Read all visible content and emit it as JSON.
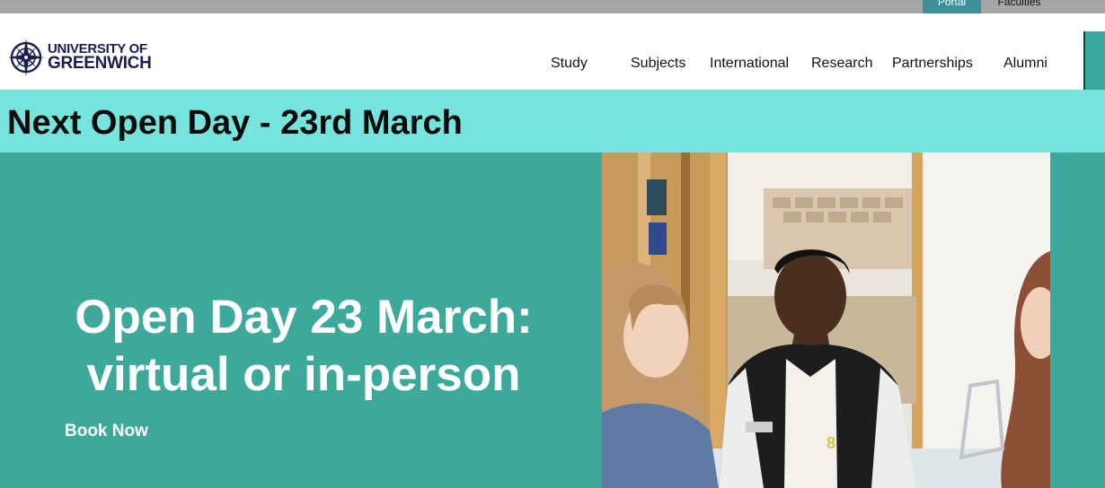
{
  "utility": {
    "portal_label": "Portal",
    "faculties_label": "Faculties"
  },
  "header": {
    "logo": {
      "line1": "UNIVERSITY OF",
      "line2": "GREENWICH",
      "icon": "compass-crest-icon"
    },
    "nav": [
      {
        "label": "Study"
      },
      {
        "label": "Subjects"
      },
      {
        "label": "International"
      },
      {
        "label": "Research"
      },
      {
        "label": "Partnerships"
      },
      {
        "label": "Alumni"
      }
    ]
  },
  "banner": {
    "text": "Next Open Day - 23rd March"
  },
  "hero": {
    "headline_line1": "Open Day 23 March:",
    "headline_line2": "virtual or in-person",
    "cta_label": "Book Now"
  },
  "colors": {
    "banner_bg": "#76e4dc",
    "hero_bg": "#3da99b",
    "brand_navy": "#1b1d4f",
    "utility_bar": "#a6a6a6"
  }
}
